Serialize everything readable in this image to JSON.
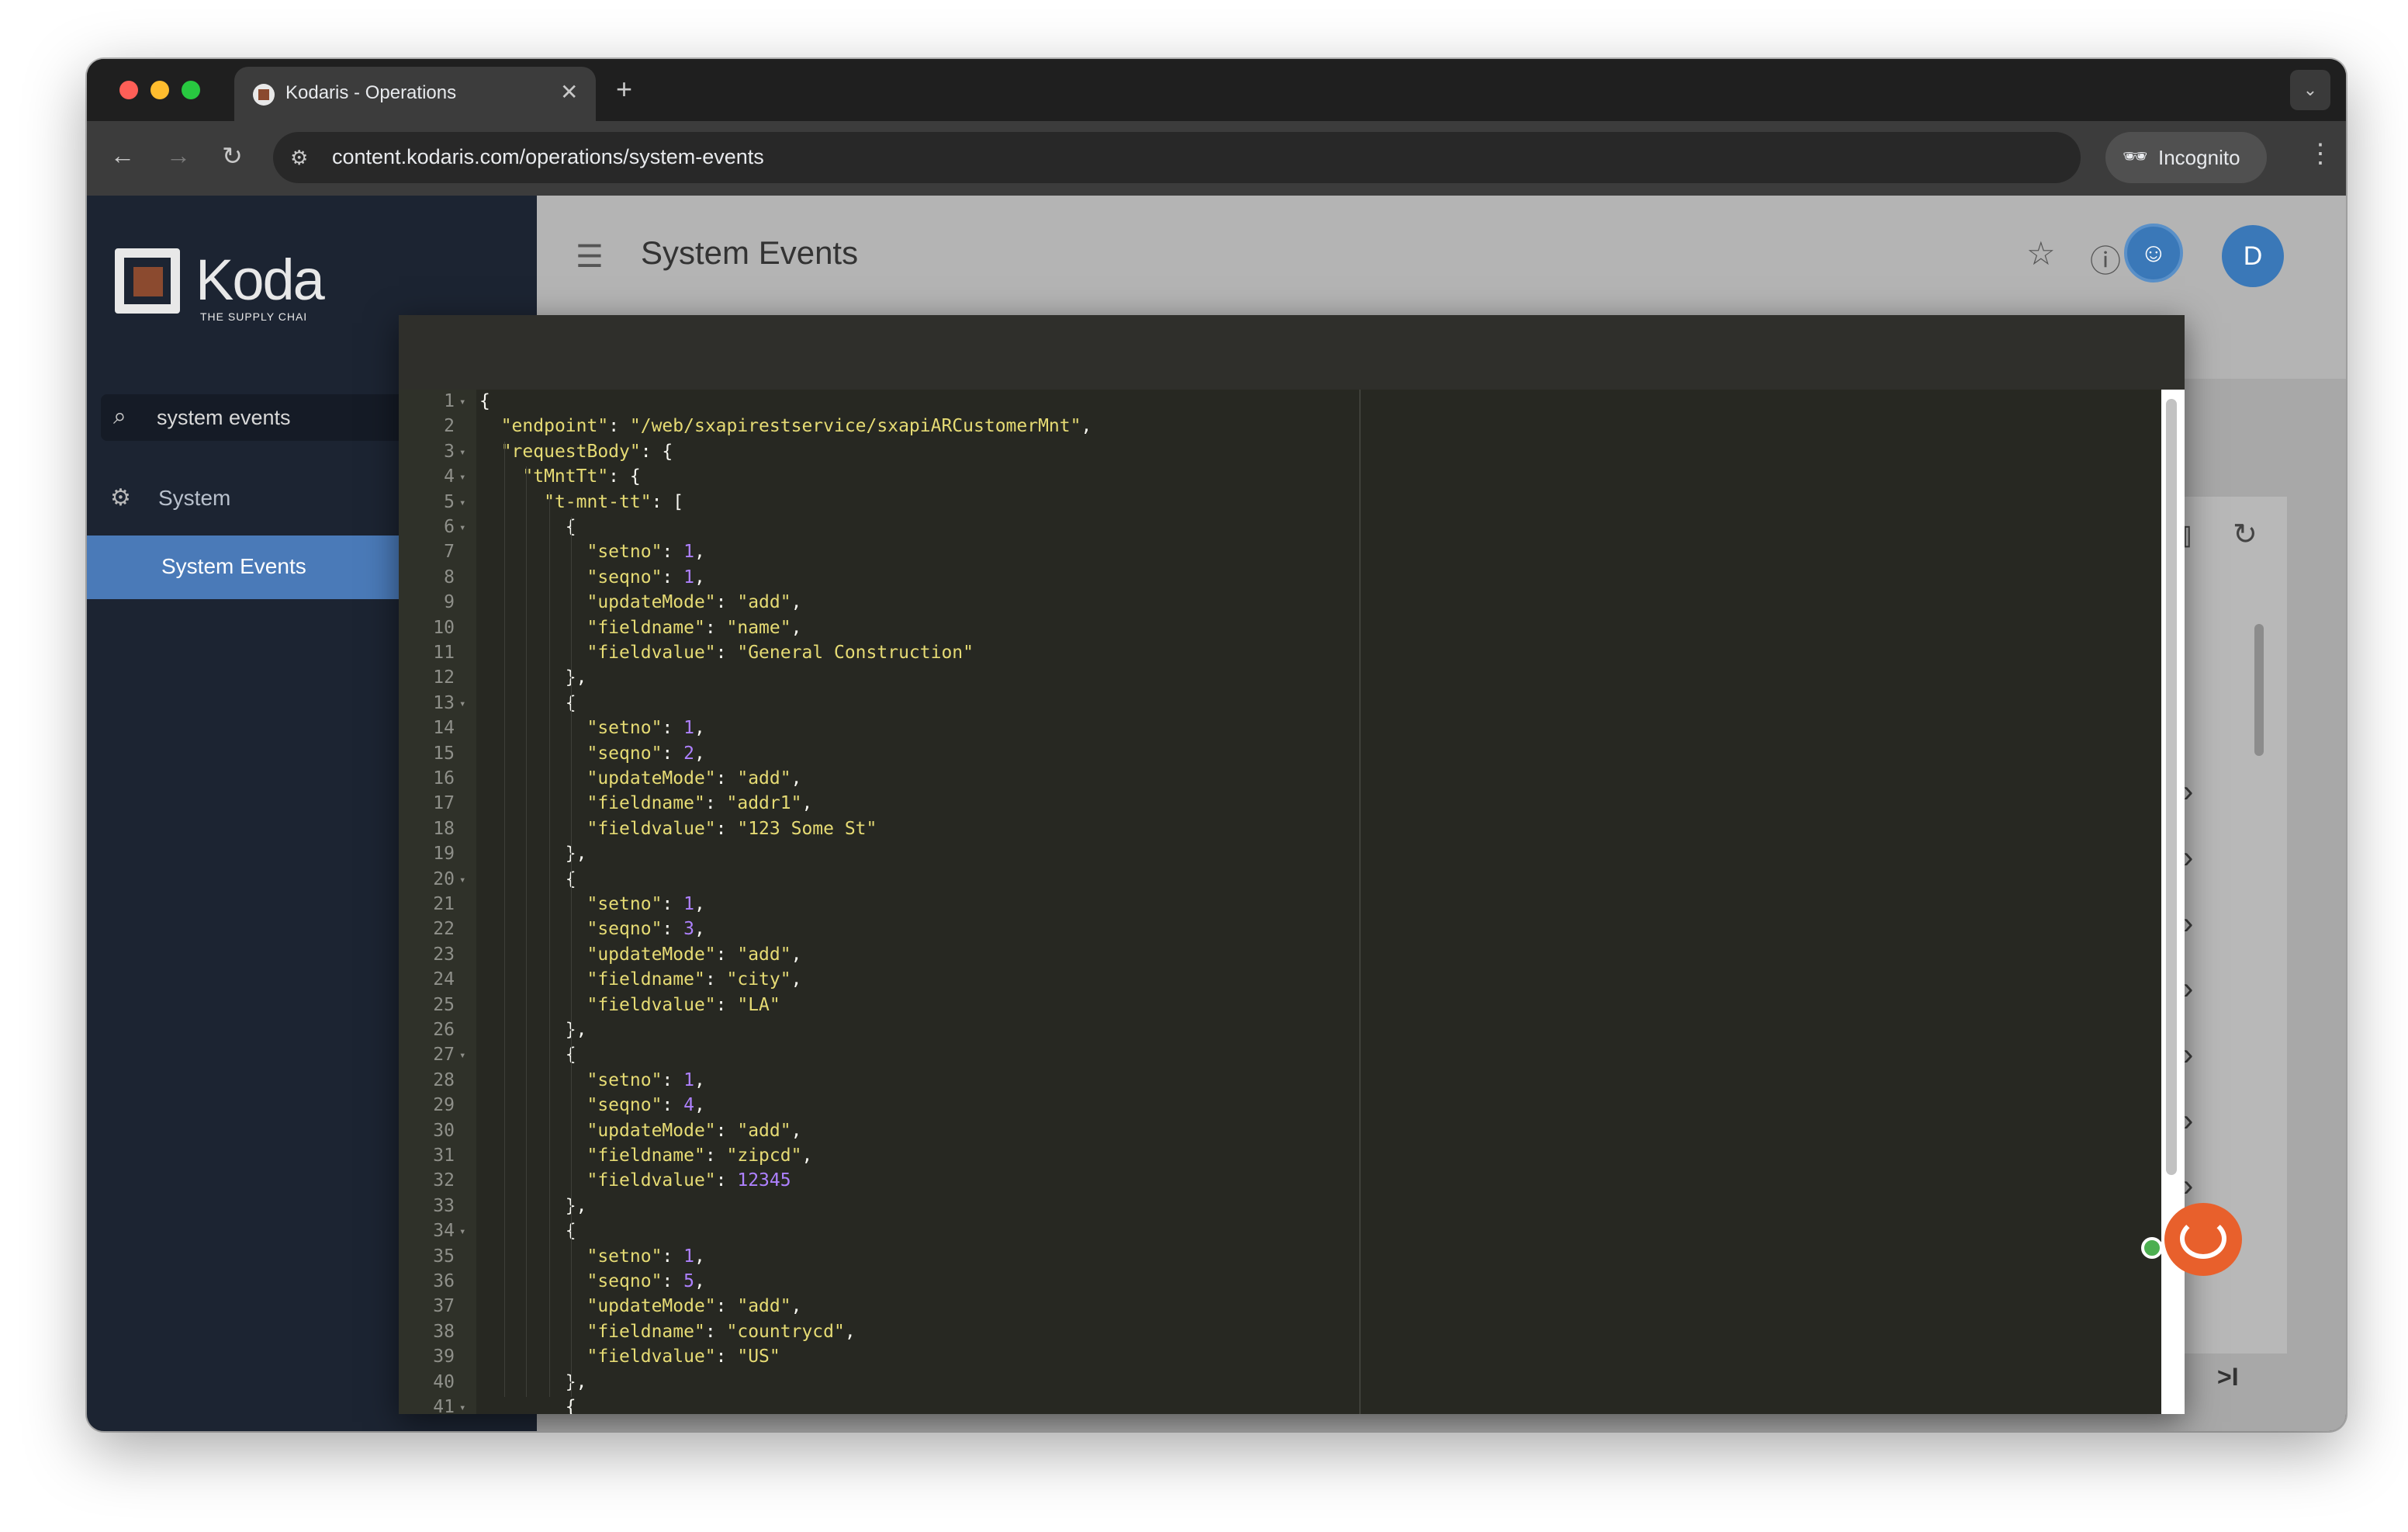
{
  "browser": {
    "tab_title": "Kodaris - Operations",
    "url": "content.kodaris.com/operations/system-events",
    "incognito_label": "Incognito",
    "icons": [
      "back-icon",
      "forward-icon",
      "reload-icon",
      "site-settings-icon",
      "eye-icon",
      "star-icon",
      "incognito-icon",
      "more-icon"
    ]
  },
  "sidebar": {
    "logo_text": "Koda",
    "logo_tagline": "THE SUPPLY CHAI",
    "search_value": "system events",
    "section_label": "System",
    "active_item": "System Events"
  },
  "header": {
    "title": "System Events",
    "avatar_letter": "D"
  },
  "pager": {
    "prev": "‹",
    "next": "›",
    "last": ">I"
  },
  "editor": {
    "lines": [
      {
        "num": "1",
        "fold": true
      },
      {
        "num": "2"
      },
      {
        "num": "3",
        "fold": true
      },
      {
        "num": "4",
        "fold": true
      },
      {
        "num": "5",
        "fold": true
      },
      {
        "num": "6",
        "fold": true
      },
      {
        "num": "7"
      },
      {
        "num": "8"
      },
      {
        "num": "9"
      },
      {
        "num": "10"
      },
      {
        "num": "11"
      },
      {
        "num": "12"
      },
      {
        "num": "13",
        "fold": true
      },
      {
        "num": "14"
      },
      {
        "num": "15"
      },
      {
        "num": "16"
      },
      {
        "num": "17"
      },
      {
        "num": "18"
      },
      {
        "num": "19"
      },
      {
        "num": "20",
        "fold": true
      },
      {
        "num": "21"
      },
      {
        "num": "22"
      },
      {
        "num": "23"
      },
      {
        "num": "24"
      },
      {
        "num": "25"
      },
      {
        "num": "26"
      },
      {
        "num": "27",
        "fold": true
      },
      {
        "num": "28"
      },
      {
        "num": "29"
      },
      {
        "num": "30"
      },
      {
        "num": "31"
      },
      {
        "num": "32"
      },
      {
        "num": "33"
      },
      {
        "num": "34",
        "fold": true
      },
      {
        "num": "35"
      },
      {
        "num": "36"
      },
      {
        "num": "37"
      },
      {
        "num": "38"
      },
      {
        "num": "39"
      },
      {
        "num": "40"
      },
      {
        "num": "41",
        "fold": true
      }
    ],
    "code": [
      "{",
      "  \"endpoint\": \"/web/sxapirestservice/sxapiARCustomerMnt\",",
      "  \"requestBody\": {",
      "    \"tMntTt\": {",
      "      \"t-mnt-tt\": [",
      "        {",
      "          \"setno\": 1,",
      "          \"seqno\": 1,",
      "          \"updateMode\": \"add\",",
      "          \"fieldname\": \"name\",",
      "          \"fieldvalue\": \"General Construction\"",
      "        },",
      "        {",
      "          \"setno\": 1,",
      "          \"seqno\": 2,",
      "          \"updateMode\": \"add\",",
      "          \"fieldname\": \"addr1\",",
      "          \"fieldvalue\": \"123 Some St\"",
      "        },",
      "        {",
      "          \"setno\": 1,",
      "          \"seqno\": 3,",
      "          \"updateMode\": \"add\",",
      "          \"fieldname\": \"city\",",
      "          \"fieldvalue\": \"LA\"",
      "        },",
      "        {",
      "          \"setno\": 1,",
      "          \"seqno\": 4,",
      "          \"updateMode\": \"add\",",
      "          \"fieldname\": \"zipcd\",",
      "          \"fieldvalue\": 12345",
      "        },",
      "        {",
      "          \"setno\": 1,",
      "          \"seqno\": 5,",
      "          \"updateMode\": \"add\",",
      "          \"fieldname\": \"countrycd\",",
      "          \"fieldvalue\": \"US\"",
      "        },",
      "        {"
    ]
  },
  "colors": {
    "sidebar_bg": "#1c2432",
    "sidebar_active": "#4a7ab8",
    "editor_bg": "#272822",
    "string": "#e6db74",
    "number": "#ae81ff",
    "text": "#f8f8f2",
    "chat_accent": "#e8602c"
  }
}
